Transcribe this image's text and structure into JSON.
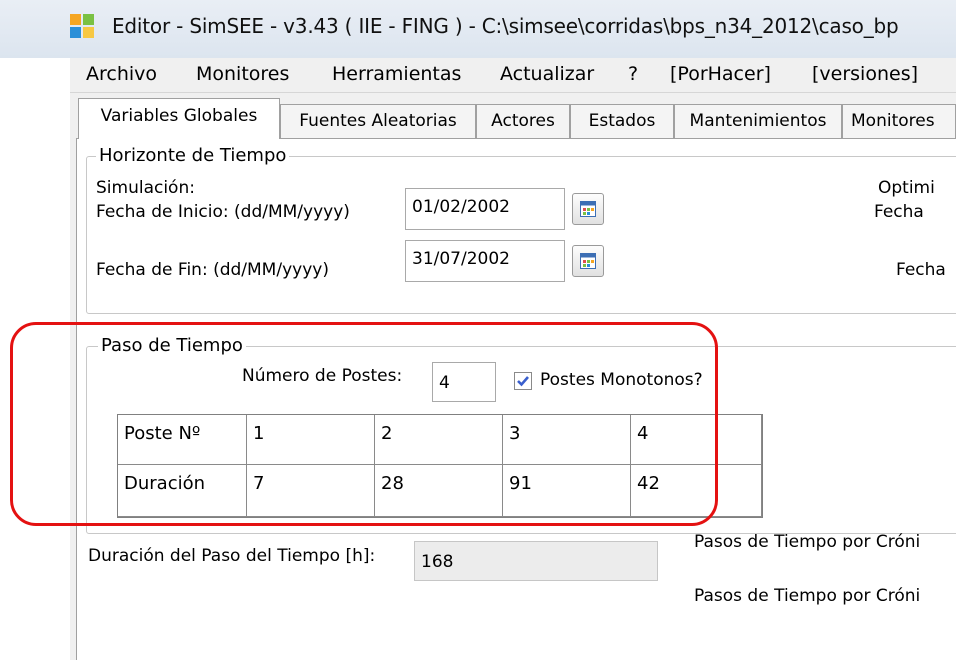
{
  "window": {
    "title": "Editor - SimSEE - v3.43 ( IIE - FING ) - C:\\simsee\\corridas\\bps_n34_2012\\caso_bp"
  },
  "menu": [
    "Archivo",
    "Monitores",
    "Herramientas",
    "Actualizar",
    "?",
    "[PorHacer]",
    "[versiones]"
  ],
  "tabs": [
    "Variables Globales",
    "Fuentes Aleatorias",
    "Actores",
    "Estados",
    "Mantenimientos",
    "Monitores"
  ],
  "active_tab": "Variables Globales",
  "horizonte": {
    "legend": "Horizonte de Tiempo",
    "simulacion_label": "Simulación:",
    "fecha_inicio_label": "Fecha de Inicio: (dd/MM/yyyy)",
    "fecha_inicio_value": "01/02/2002",
    "fecha_fin_label": "Fecha de Fin: (dd/MM/yyyy)",
    "fecha_fin_value": "31/07/2002",
    "optim_label": "Optimi",
    "optim_fecha1": "Fecha",
    "optim_fecha2": "Fecha"
  },
  "paso": {
    "legend": "Paso de Tiempo",
    "num_postes_label": "Número de Postes:",
    "num_postes_value": "4",
    "monotonos_label": "Postes Monotonos?",
    "monotonos_checked": true,
    "grid": {
      "rows": [
        [
          "Poste Nº",
          "1",
          "2",
          "3",
          "4"
        ],
        [
          "Duración",
          "7",
          "28",
          "91",
          "42"
        ]
      ]
    }
  },
  "duracion": {
    "label": "Duración del Paso del Tiempo [h]:",
    "value": "168"
  },
  "pasos": {
    "label1": "Pasos de Tiempo por Cróni",
    "label2": "Pasos de Tiempo por Cróni"
  },
  "colors": {
    "highlight": "#e41111",
    "checkbox_check": "#3a5fcd"
  }
}
